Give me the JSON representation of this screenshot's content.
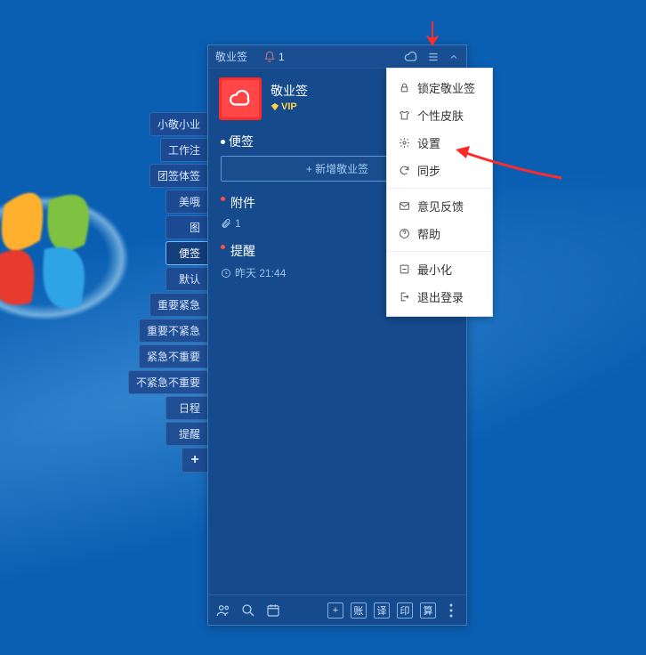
{
  "app": {
    "title": "敬业签",
    "bell_count": "1",
    "username": "敬业签",
    "vip_label": "VIP"
  },
  "side_tabs": [
    "小敬小业",
    "工作注",
    "团签体签",
    "美哦",
    "图",
    "便签",
    "默认",
    "重要紧急",
    "重要不紧急",
    "紧急不重要",
    "不紧急不重要",
    "日程",
    "提醒"
  ],
  "side_add": "+",
  "sections": {
    "notes": {
      "title": "便签",
      "add_btn": "+ 新增敬业签"
    },
    "attachments": {
      "title": "附件",
      "count": "1"
    },
    "reminder": {
      "title": "提醒",
      "time": "昨天 21:44"
    }
  },
  "bottom_buttons": [
    "+",
    "账",
    "译",
    "印",
    "算"
  ],
  "menu": {
    "lock": "锁定敬业签",
    "skin": "个性皮肤",
    "settings": "设置",
    "sync": "同步",
    "feedback": "意见反馈",
    "help": "帮助",
    "minimize": "最小化",
    "logout": "退出登录"
  }
}
